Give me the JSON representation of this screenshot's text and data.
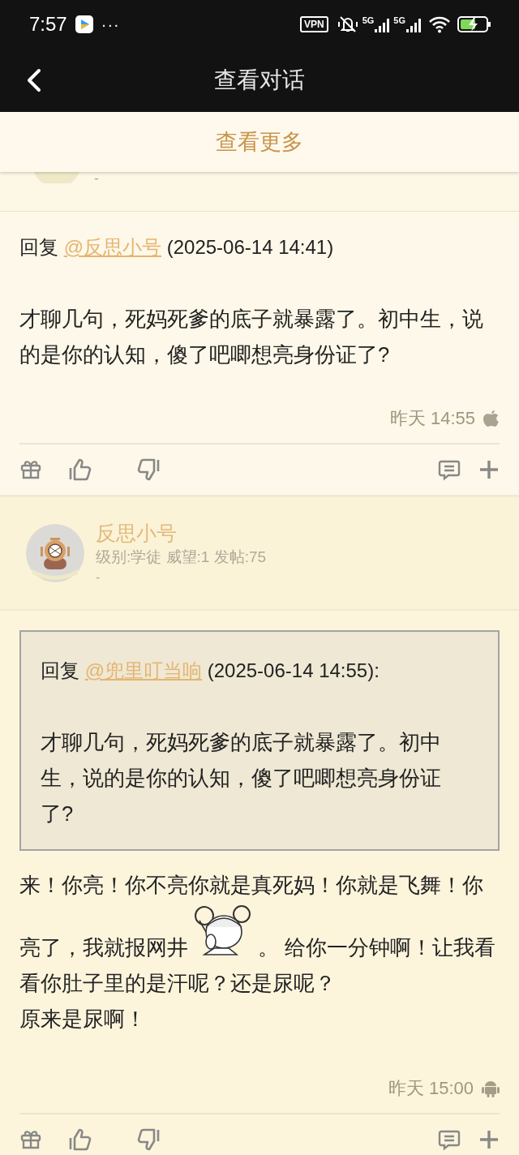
{
  "status_bar": {
    "time": "7:57",
    "overflow": "···",
    "vpn": "VPN",
    "network_1": "5G",
    "network_2": "5G"
  },
  "app_bar": {
    "title": "查看对话"
  },
  "load_more": {
    "label": "查看更多"
  },
  "top_header": {
    "signature": "-"
  },
  "posts": [
    {
      "kind": "reply",
      "reply": {
        "prefix": "回复",
        "mention": "@反思小号",
        "time": "(2025-06-14 14:41)"
      },
      "paragraphs": [
        [
          {
            "kind": "text",
            "text": "才聊几句，死妈死爹的底子就暴露了。初中生，说的是你的认知，傻了吧唧想亮身份证了?"
          }
        ]
      ],
      "time": "昨天 14:55",
      "device": {
        "kind": "apple"
      }
    },
    {
      "kind": "user_header",
      "name": "反思小号",
      "stats": "级别:学徒 威望:1 发帖:75",
      "signature": "-"
    },
    {
      "kind": "quote_reply",
      "quote": {
        "prefix": "回复",
        "mention": "@兜里叮当响",
        "time": "(2025-06-14 14:55):",
        "content": "才聊几句，死妈死爹的底子就暴露了。初中生，说的是你的认知，傻了吧唧想亮身份证了?"
      },
      "lines": [
        [
          {
            "kind": "text",
            "text": "来！你亮！你不亮你就是真死妈！你就是飞舞！你"
          }
        ],
        [
          {
            "kind": "text",
            "text": "亮了，我就报网井"
          },
          {
            "kind": "picture"
          },
          {
            "kind": "text",
            "text": "。 给你一分钟啊！让我看"
          }
        ],
        [
          {
            "kind": "text",
            "text": "看你肚子里的是汗呢？还是尿呢？"
          }
        ],
        [
          {
            "kind": "text",
            "text": "原来是尿啊！"
          }
        ]
      ],
      "time": "昨天 15:00",
      "device": {
        "kind": "android"
      }
    }
  ]
}
